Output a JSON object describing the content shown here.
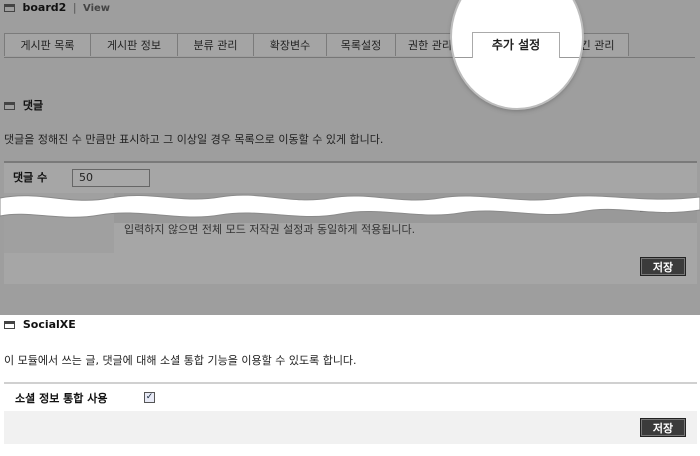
{
  "header": {
    "module_name": "board2",
    "separator": "|",
    "page": "View"
  },
  "tabs": [
    {
      "label": "게시판 목록"
    },
    {
      "label": "게시판 정보"
    },
    {
      "label": "분류 관리"
    },
    {
      "label": "확장변수"
    },
    {
      "label": "목록설정"
    },
    {
      "label": "권한 관리"
    },
    {
      "label": "추가 설정"
    },
    {
      "label": "스킨 관리"
    }
  ],
  "comment_section": {
    "title": "댓글",
    "description": "댓글을 정해진 수 만큼만 표시하고 그 이상일 경우 목록으로 이동할 수 있게 합니다.",
    "field_label": "댓글 수",
    "field_value": "50",
    "hidden_text": "입력하지 않으면 전체 모드 저작권 설정과 동일하게 적용됩니다.",
    "save_label": "저장"
  },
  "social_section": {
    "title": "SocialXE",
    "description": "이 모듈에서 쓰는 글, 댓글에 대해 소셜 통합 기능을 이용할 수 있도록 합니다.",
    "field_label": "소셜 정보 통합 사용",
    "checked": true,
    "checkmark": "✓",
    "save_label": "저장"
  }
}
